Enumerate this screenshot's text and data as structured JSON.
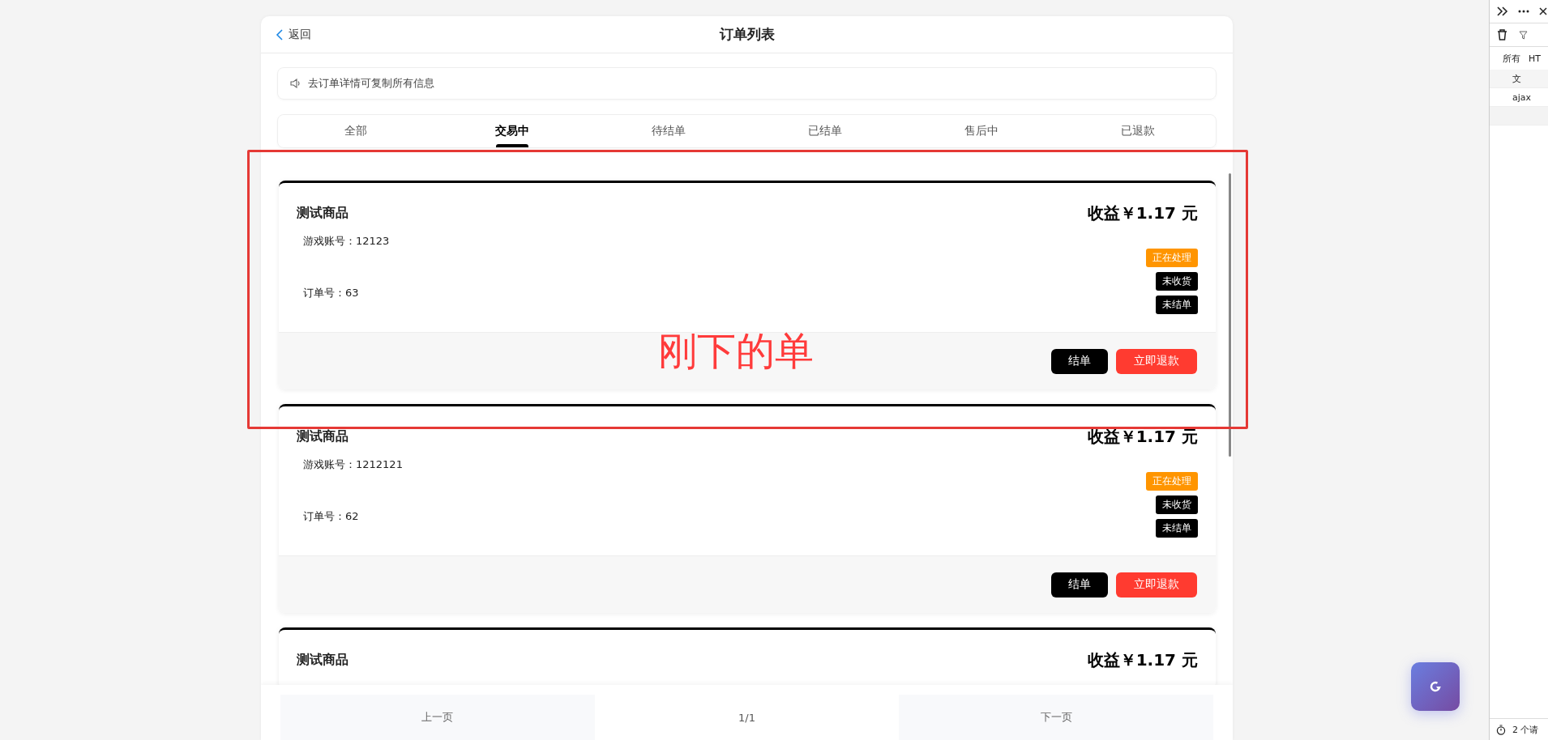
{
  "header": {
    "back": "返回",
    "title": "订单列表"
  },
  "notice": "去订单详情可复制所有信息",
  "tabs": [
    {
      "label": "全部",
      "selected": false
    },
    {
      "label": "交易中",
      "selected": true
    },
    {
      "label": "待结单",
      "selected": false
    },
    {
      "label": "已结单",
      "selected": false
    },
    {
      "label": "售后中",
      "selected": false
    },
    {
      "label": "已退款",
      "selected": false
    }
  ],
  "orders": [
    {
      "product": "测试商品",
      "income": "收益￥1.17 元",
      "account": "游戏账号：12123",
      "order_no": "订单号：63",
      "tags": [
        {
          "label": "正在处理",
          "color": "#ff9500"
        },
        {
          "label": "未收货",
          "color": "#000000"
        },
        {
          "label": "未结单",
          "color": "#000000"
        }
      ],
      "buttons": [
        {
          "label": "结单",
          "kind": "dark"
        },
        {
          "label": "立即退款",
          "kind": "danger"
        }
      ]
    },
    {
      "product": "测试商品",
      "income": "收益￥1.17 元",
      "account": "游戏账号：1212121",
      "order_no": "订单号：62",
      "tags": [
        {
          "label": "正在处理",
          "color": "#ff9500"
        },
        {
          "label": "未收货",
          "color": "#000000"
        },
        {
          "label": "未结单",
          "color": "#000000"
        }
      ],
      "buttons": [
        {
          "label": "结单",
          "kind": "dark"
        },
        {
          "label": "立即退款",
          "kind": "danger"
        }
      ]
    },
    {
      "product": "测试商品",
      "income": "收益￥1.17 元"
    }
  ],
  "pager": {
    "prev": "上一页",
    "page": "1/1",
    "next": "下一页"
  },
  "annotation": "刚下的单",
  "devtools": {
    "filter_tab": "所有",
    "filter_tab_2": "HT",
    "column": "文",
    "row": "ajax",
    "status": "2 个请"
  }
}
